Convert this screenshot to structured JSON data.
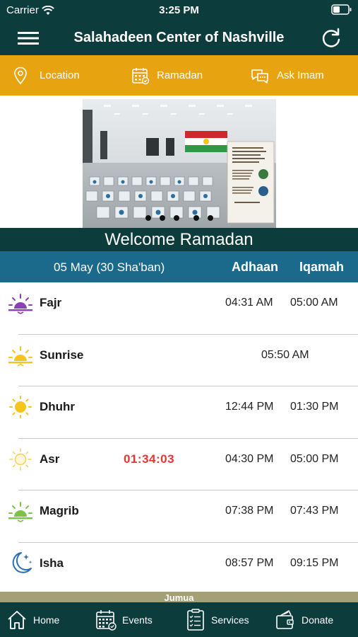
{
  "status_bar": {
    "carrier": "Carrier",
    "time": "3:25 PM"
  },
  "nav": {
    "title": "Salahadeen Center of Nashville"
  },
  "quick_links": [
    {
      "label": "Location",
      "icon": "location-pin-icon"
    },
    {
      "label": "Ramadan",
      "icon": "calendar-icon"
    },
    {
      "label": "Ask Imam",
      "icon": "chat-bubbles-icon"
    }
  ],
  "banner": {
    "slide_count": 5,
    "active_slide": 3
  },
  "welcome_text": "Welcome Ramadan",
  "table": {
    "date": "05 May (30 Sha'ban)",
    "col_adhaan": "Adhaan",
    "col_iqamah": "Iqamah"
  },
  "prayers": [
    {
      "name": "Fajr",
      "adhaan": "04:31 AM",
      "iqamah": "05:00 AM",
      "icon": "sunrise-purple-icon"
    },
    {
      "name": "Sunrise",
      "time": "05:50 AM",
      "icon": "sunrise-yellow-icon"
    },
    {
      "name": "Dhuhr",
      "adhaan": "12:44 PM",
      "iqamah": "01:30 PM",
      "icon": "sun-icon"
    },
    {
      "name": "Asr",
      "countdown": "01:34:03",
      "adhaan": "04:30 PM",
      "iqamah": "05:00 PM",
      "icon": "sun-light-icon"
    },
    {
      "name": "Magrib",
      "adhaan": "07:38 PM",
      "iqamah": "07:43 PM",
      "icon": "sunset-green-icon"
    },
    {
      "name": "Isha",
      "adhaan": "08:57 PM",
      "iqamah": "09:15 PM",
      "icon": "moon-stars-icon"
    }
  ],
  "jumua_label": "Jumua",
  "tabs": [
    {
      "label": "Home",
      "icon": "home-icon"
    },
    {
      "label": "Events",
      "icon": "events-calendar-icon"
    },
    {
      "label": "Services",
      "icon": "services-list-icon"
    },
    {
      "label": "Donate",
      "icon": "donate-wallet-icon"
    }
  ],
  "colors": {
    "header": "#0d3c3c",
    "accent": "#e8a311",
    "table_header": "#1b6a8c",
    "countdown": "#e53535"
  }
}
